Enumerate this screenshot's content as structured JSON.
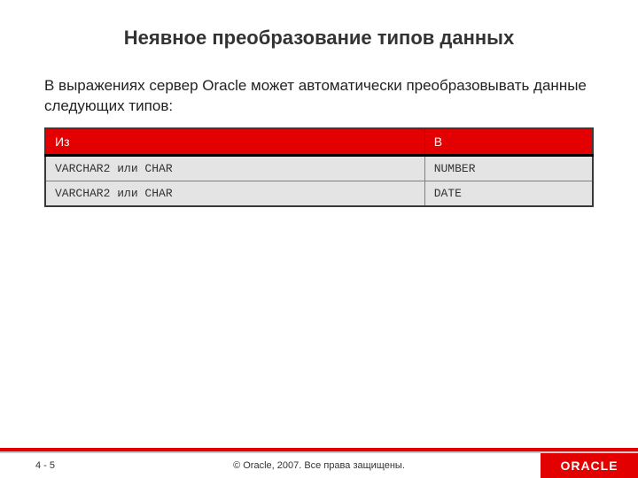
{
  "slide": {
    "title": "Неявное преобразование типов данных",
    "body_text": "В выражениях сервер Oracle может автоматически преобразовывать данные следующих типов:"
  },
  "table": {
    "headers": {
      "from": "Из",
      "to": "В"
    },
    "rows": [
      {
        "from": "VARCHAR2 или CHAR",
        "to": "NUMBER"
      },
      {
        "from": "VARCHAR2 или CHAR",
        "to": "DATE"
      }
    ]
  },
  "footer": {
    "page": "4 - 5",
    "copyright": "© Oracle, 2007. Все права защищены.",
    "logo_text": "ORACLE"
  }
}
